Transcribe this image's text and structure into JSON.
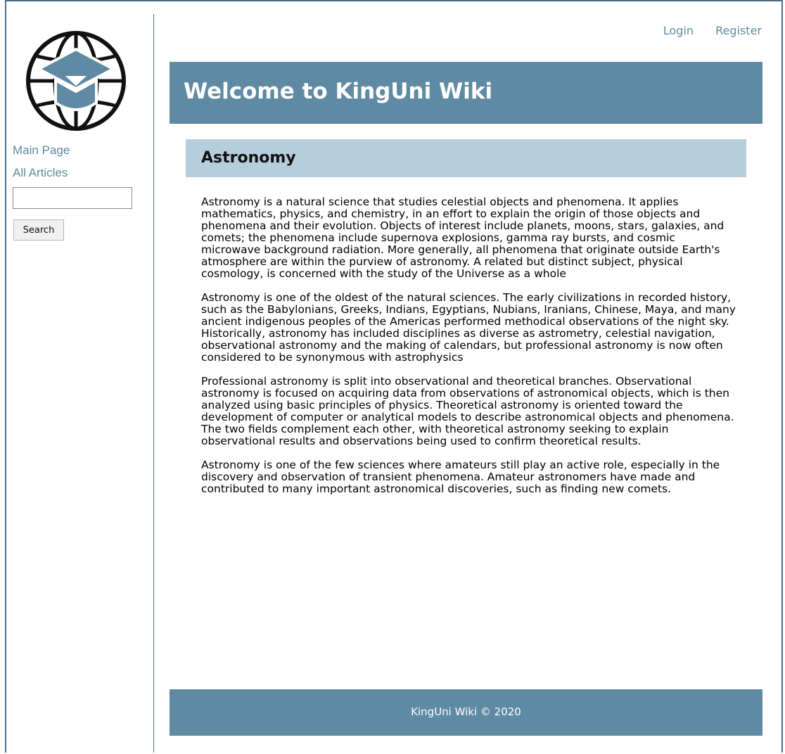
{
  "brand": {
    "logo_icon": "globe-graduation-cap-icon",
    "colors": {
      "accent": "#5f8aa3",
      "section": "#b6cddc",
      "border": "#4a6d8a"
    }
  },
  "sidebar": {
    "links": [
      {
        "label": "Main Page"
      },
      {
        "label": "All Articles"
      }
    ],
    "search": {
      "value": "",
      "placeholder": "",
      "button_label": "Search"
    }
  },
  "header": {
    "login_label": "Login",
    "register_label": "Register",
    "title": "Welcome to KingUni Wiki"
  },
  "article": {
    "title": "Astronomy",
    "paragraphs": [
      "Astronomy is a natural science that studies celestial objects and phenomena. It applies mathematics, physics, and chemistry, in an effort to explain the origin of those objects and phenomena and their evolution. Objects of interest include planets, moons, stars, galaxies, and comets; the phenomena include supernova explosions, gamma ray bursts, and cosmic microwave background radiation. More generally, all phenomena that originate outside Earth's atmosphere are within the purview of astronomy. A related but distinct subject, physical cosmology, is concerned with the study of the Universe as a whole",
      "Astronomy is one of the oldest of the natural sciences. The early civilizations in recorded history, such as the Babylonians, Greeks, Indians, Egyptians, Nubians, Iranians, Chinese, Maya, and many ancient indigenous peoples of the Americas performed methodical observations of the night sky. Historically, astronomy has included disciplines as diverse as astrometry, celestial navigation, observational astronomy and the making of calendars, but professional astronomy is now often considered to be synonymous with astrophysics",
      "Professional astronomy is split into observational and theoretical branches. Observational astronomy is focused on acquiring data from observations of astronomical objects, which is then analyzed using basic principles of physics. Theoretical astronomy is oriented toward the development of computer or analytical models to describe astronomical objects and phenomena. The two fields complement each other, with theoretical astronomy seeking to explain observational results and observations being used to confirm theoretical results.",
      "Astronomy is one of the few sciences where amateurs still play an active role, especially in the discovery and observation of transient phenomena. Amateur astronomers have made and contributed to many important astronomical discoveries, such as finding new comets."
    ]
  },
  "footer": {
    "text": "KingUni Wiki © 2020"
  }
}
